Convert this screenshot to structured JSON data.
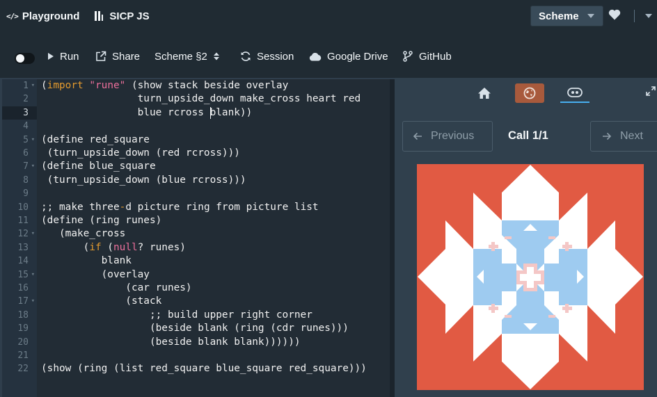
{
  "topbar": {
    "playground_label": "Playground",
    "sicp_label": "SICP JS",
    "language_select": "Scheme"
  },
  "toolbar": {
    "run_label": "Run",
    "share_label": "Share",
    "variant_label": "Scheme §2",
    "session_label": "Session",
    "drive_label": "Google Drive",
    "github_label": "GitHub"
  },
  "editor": {
    "line_numbers": [
      "1",
      "2",
      "3",
      "4",
      "5",
      "6",
      "7",
      "8",
      "9",
      "10",
      "11",
      "12",
      "13",
      "14",
      "15",
      "16",
      "17",
      "18",
      "19",
      "20",
      "21",
      "22"
    ],
    "lines": [
      "(import \"rune\" (show stack beside overlay",
      "                turn_upside_down make_cross heart red",
      "                blue rcross blank))",
      "",
      "(define red_square",
      " (turn_upside_down (red rcross)))",
      "(define blue_square",
      " (turn_upside_down (blue rcross)))",
      "",
      ";; make three-d picture ring from picture list",
      "(define (ring runes)",
      "   (make_cross",
      "       (if (null? runes)",
      "          blank",
      "          (overlay",
      "              (car runes)",
      "              (stack",
      "                  ;; build upper right corner",
      "                  (beside blank (ring (cdr runes)))",
      "                  (beside blank blank))))))",
      "",
      "(show (ring (list red_square blue_square red_square)))"
    ]
  },
  "side_panel": {
    "tabs": [
      "home-icon",
      "globe-icon",
      "data-visualizer-icon"
    ],
    "previous_label": "Previous",
    "call_label": "Call 1/1",
    "next_label": "Next"
  },
  "colors": {
    "rune_red": "#e15a43",
    "rune_blue": "#9ecbf0",
    "rune_pink": "#f4c7c6",
    "rune_white": "#ffffff",
    "keyword": "#e39a2e",
    "string": "#ec6f9b"
  }
}
